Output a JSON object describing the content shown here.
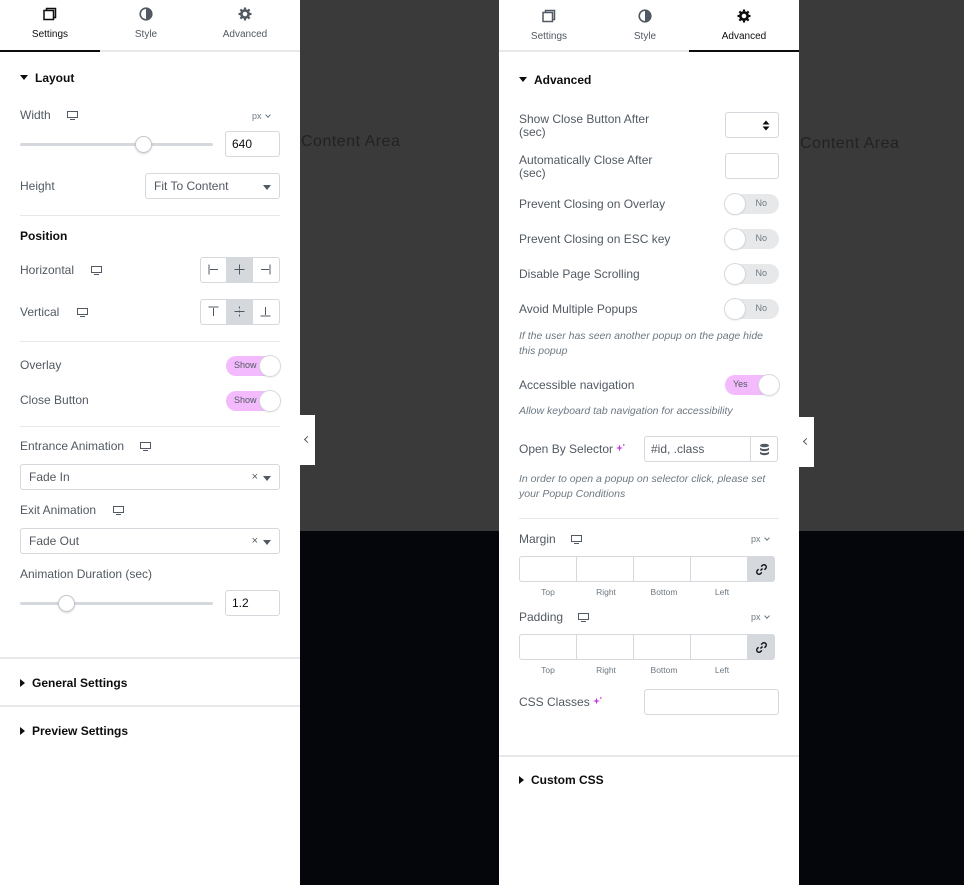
{
  "canvas": {
    "content_area_label": "Content Area"
  },
  "left_panel": {
    "tabs": [
      {
        "label": "Settings",
        "icon": "settings-window-icon",
        "active": true
      },
      {
        "label": "Style",
        "icon": "style-half-circle-icon",
        "active": false
      },
      {
        "label": "Advanced",
        "icon": "gear-icon",
        "active": false
      }
    ],
    "layout": {
      "title": "Layout",
      "width_label": "Width",
      "width_unit": "px",
      "width_value": "640",
      "width_slider_fraction": 0.64,
      "height_label": "Height",
      "height_value": "Fit To Content",
      "position_title": "Position",
      "horizontal_label": "Horizontal",
      "vertical_label": "Vertical",
      "overlay_label": "Overlay",
      "overlay_toggle": "Show",
      "close_button_label": "Close Button",
      "close_button_toggle": "Show",
      "entrance_animation_label": "Entrance Animation",
      "entrance_animation_value": "Fade In",
      "exit_animation_label": "Exit Animation",
      "exit_animation_value": "Fade Out",
      "animation_duration_label": "Animation Duration (sec)",
      "animation_duration_value": "1.2",
      "animation_duration_fraction": 0.24
    },
    "general_settings_title": "General Settings",
    "preview_settings_title": "Preview Settings"
  },
  "right_panel": {
    "tabs": [
      {
        "label": "Settings",
        "icon": "settings-window-icon",
        "active": false
      },
      {
        "label": "Style",
        "icon": "style-half-circle-icon",
        "active": false
      },
      {
        "label": "Advanced",
        "icon": "gear-icon",
        "active": true
      }
    ],
    "advanced": {
      "title": "Advanced",
      "show_close_after_label": "Show Close Button After (sec)",
      "auto_close_after_label": "Automatically Close After (sec)",
      "prevent_overlay_label": "Prevent Closing on Overlay",
      "prevent_overlay_toggle": "No",
      "prevent_esc_label": "Prevent Closing on ESC key",
      "prevent_esc_toggle": "No",
      "disable_scrolling_label": "Disable Page Scrolling",
      "disable_scrolling_toggle": "No",
      "avoid_multiple_label": "Avoid Multiple Popups",
      "avoid_multiple_toggle": "No",
      "avoid_multiple_help": "If the user has seen another popup on the page hide this popup",
      "accessible_nav_label": "Accessible navigation",
      "accessible_nav_toggle": "Yes",
      "accessible_nav_help": "Allow keyboard tab navigation for accessibility",
      "open_by_selector_label": "Open By Selector",
      "open_by_selector_placeholder": "#id, .class",
      "open_by_selector_help": "In order to open a popup on selector click, please set your Popup Conditions",
      "margin_label": "Margin",
      "margin_unit": "px",
      "padding_label": "Padding",
      "padding_unit": "px",
      "dim_labels": [
        "Top",
        "Right",
        "Bottom",
        "Left"
      ],
      "css_classes_label": "CSS Classes"
    },
    "custom_css_title": "Custom CSS"
  }
}
